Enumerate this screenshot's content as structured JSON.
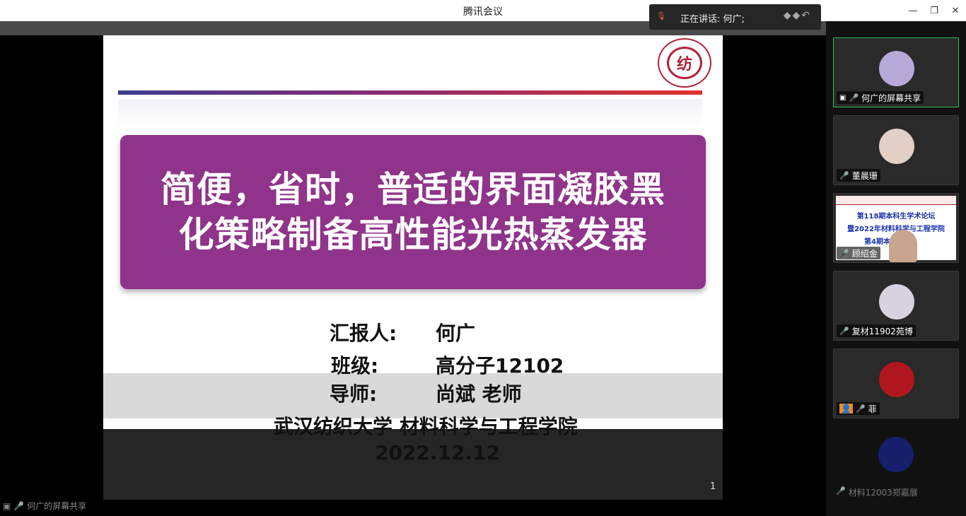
{
  "window": {
    "title": "腾讯会议"
  },
  "speaking": {
    "label": "正在讲话: 何广;"
  },
  "slide": {
    "title_line1": "简便，省时，普适的界面凝胶黑",
    "title_line2": "化策略制备高性能光热蒸发器",
    "reporter_label": "汇报人:",
    "reporter_value": "何广",
    "class_label": "班级:",
    "class_value": "高分子12102",
    "advisor_label": "导师:",
    "advisor_value": "尚斌 老师",
    "affiliation": "武汉纺织大学 材料科学与工程学院",
    "date": "2022.12.12",
    "page_number": "1",
    "logo_char": "纺"
  },
  "participants": [
    {
      "name": "何广的屏幕共享",
      "active": true,
      "avatar_color": "#b6a9d8"
    },
    {
      "name": "董晨珊",
      "active": false,
      "avatar_color": "#e2cfc6"
    },
    {
      "name": "顾绍金",
      "active": false,
      "thumbnail_lines": [
        "第118期本科生学术论坛",
        "暨2022年材料科学与工程学院",
        "第4期本"
      ]
    },
    {
      "name": "复材11902苑博",
      "active": false,
      "avatar_color": "#d8d2e0"
    },
    {
      "name": "菲",
      "active": false,
      "avatar_color": "#b0161e"
    },
    {
      "name": "材料12003郑嘉展",
      "active": false,
      "avatar_color": "#1b2aa8"
    }
  ],
  "bottom_status": {
    "label": "何广的屏幕共享"
  }
}
